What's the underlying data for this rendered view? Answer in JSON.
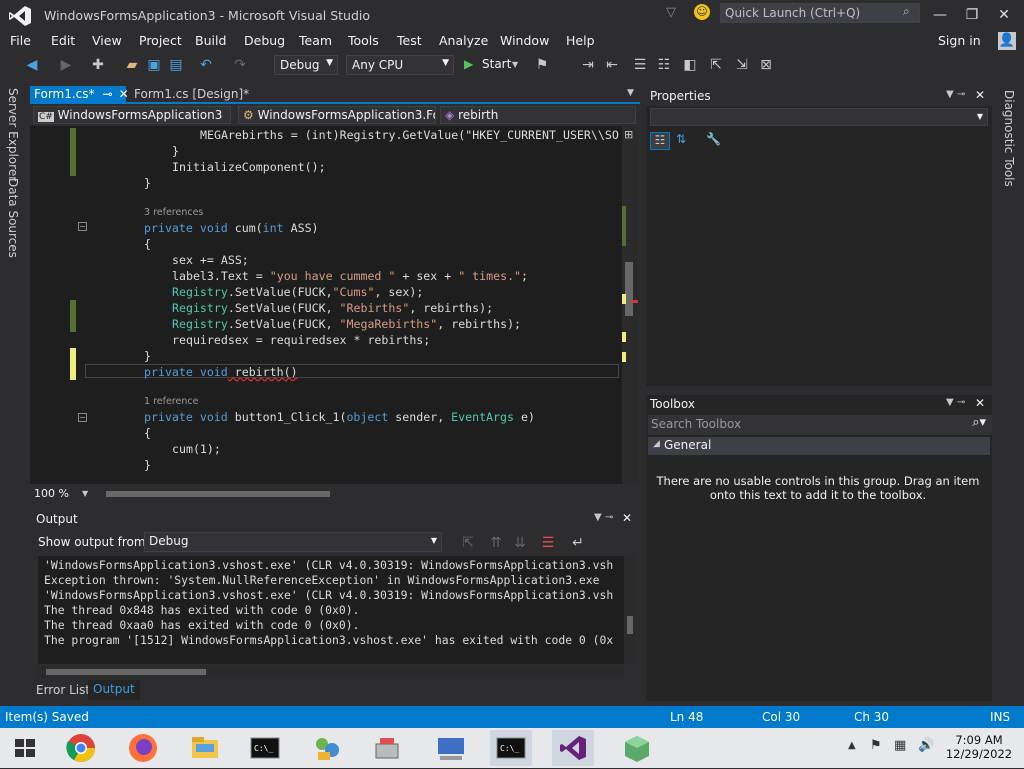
{
  "window": {
    "title": "WindowsFormsApplication3 - Microsoft Visual Studio",
    "quick_launch_placeholder": "Quick Launch (Ctrl+Q)",
    "sign_in": "Sign in"
  },
  "menu": [
    "File",
    "Edit",
    "View",
    "Project",
    "Build",
    "Debug",
    "Team",
    "Tools",
    "Test",
    "Analyze",
    "Window",
    "Help"
  ],
  "toolbar": {
    "config": "Debug",
    "platform": "Any CPU",
    "start": "Start"
  },
  "left_tabs": [
    "Server Explorer",
    "Data Sources"
  ],
  "doc_tabs": [
    "Form1.cs*",
    "Form1.cs [Design]*"
  ],
  "navbar": {
    "project": "WindowsFormsApplication3",
    "class": "WindowsFormsApplication3.Fo",
    "member": "rebirth"
  },
  "code": {
    "l1": "MEGArebirths = (int)Registry.GetValue(\"HKEY_CURRENT_USER\\\\SO",
    "l2": "}",
    "l3": "InitializeComponent();",
    "l4": "}",
    "ref1": "3 references",
    "l5a": "private void",
    "l5b": " cum(",
    "l5c": "int",
    "l5d": " ASS)",
    "l6": "{",
    "l7": "sex += ASS;",
    "l8a": "label3.Text = ",
    "l8b": "\"you have cummed \"",
    "l8c": " + sex + ",
    "l8d": "\" times.\"",
    "l8e": ";",
    "l9a": "Registry",
    "l9b": ".SetValue(FUCK,",
    "l9c": "\"Cums\"",
    "l9d": ", sex);",
    "l10a": "Registry",
    "l10b": ".SetValue(FUCK, ",
    "l10c": "\"Rebirths\"",
    "l10d": ", rebirths);",
    "l11a": "Registry",
    "l11b": ".SetValue(FUCK, ",
    "l11c": "\"MegaRebirths\"",
    "l11d": ", rebirths);",
    "l12": "requiredsex = requiredsex * rebirths;",
    "l13": "}",
    "l14a": "private void",
    "l14b": " rebirth()",
    "ref2": "1 reference",
    "l15a": "private void",
    "l15b": " button1_Click_1(",
    "l15c": "object",
    "l15d": " sender, ",
    "l15e": "EventArgs",
    "l15f": " e)",
    "l16": "{",
    "l17": "cum(1);",
    "l18": "}"
  },
  "zoom": "100 %",
  "output": {
    "title": "Output",
    "show_from_label": "Show output from:",
    "source": "Debug",
    "lines": [
      "'WindowsFormsApplication3.vshost.exe' (CLR v4.0.30319: WindowsFormsApplication3.vsh",
      "Exception thrown: 'System.NullReferenceException' in WindowsFormsApplication3.exe",
      "'WindowsFormsApplication3.vshost.exe' (CLR v4.0.30319: WindowsFormsApplication3.vsh",
      "The thread 0x848 has exited with code 0 (0x0).",
      "The thread 0xaa0 has exited with code 0 (0x0).",
      "The program '[1512] WindowsFormsApplication3.vshost.exe' has exited with code 0 (0x"
    ],
    "tabs": [
      "Error List",
      "Output"
    ]
  },
  "properties": {
    "title": "Properties"
  },
  "toolbox": {
    "title": "Toolbox",
    "search_placeholder": "Search Toolbox",
    "group": "General",
    "empty_msg_1": "There are no usable controls in this group. Drag an item",
    "empty_msg_2": "onto this text to add it to the toolbox."
  },
  "right_tab": "Diagnostic Tools",
  "status": {
    "message": "Item(s) Saved",
    "ln": "Ln 48",
    "col": "Col 30",
    "ch": "Ch 30",
    "mode": "INS"
  },
  "clock": {
    "time": "7:09 AM",
    "date": "12/29/2022"
  },
  "colors": {
    "accent": "#007acc",
    "editor_bg": "#1e1e1e"
  }
}
